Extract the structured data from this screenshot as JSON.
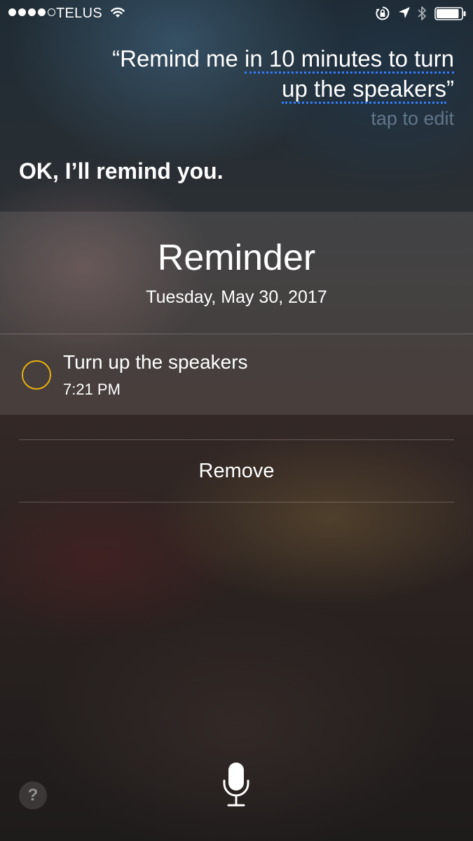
{
  "status_bar": {
    "carrier": "TELUS",
    "signal_bars_filled": 4,
    "signal_bars_total": 5,
    "battery_level": 0.9
  },
  "siri": {
    "query_open_quote": "“",
    "query_plain": "Remind me ",
    "query_editable_1": "in 10 minutes to turn",
    "query_editable_2": "up the speakers",
    "query_close_quote": "”",
    "tap_to_edit": "tap to edit",
    "response": "OK, I’ll remind you."
  },
  "reminder_card": {
    "title": "Reminder",
    "date": "Tuesday, May 30, 2017",
    "item": {
      "title": "Turn up the speakers",
      "time": "7:21 PM",
      "accent_color": "#e8b00f"
    }
  },
  "actions": {
    "remove_label": "Remove"
  },
  "bottom": {
    "help_label": "?",
    "mic_icon": "microphone-icon"
  }
}
